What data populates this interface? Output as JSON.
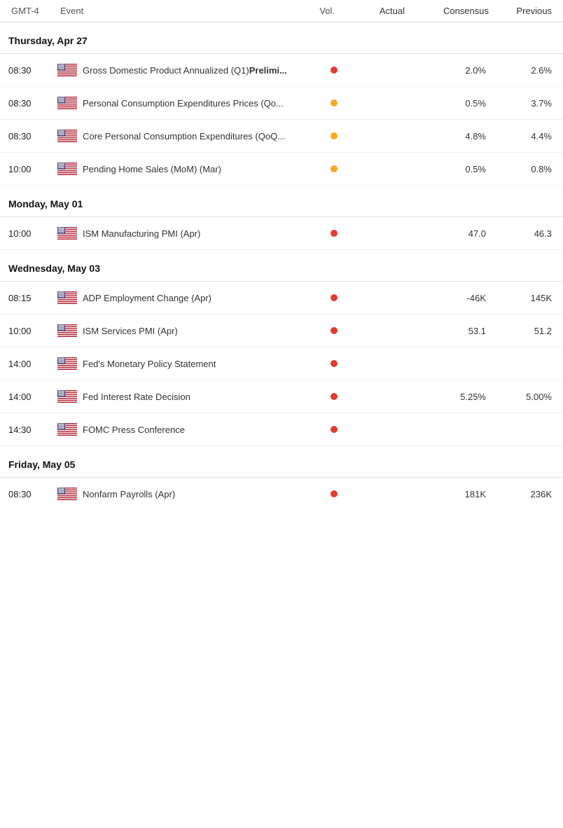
{
  "header": {
    "col_time": "GMT-4",
    "col_event": "Event",
    "col_vol": "Vol.",
    "col_actual": "Actual",
    "col_consensus": "Consensus",
    "col_previous": "Previous"
  },
  "sections": [
    {
      "id": "thu-apr-27",
      "title": "Thursday, Apr 27",
      "events": [
        {
          "time": "08:30",
          "flag": "us",
          "event_prefix": "Gross Domestic Product Annualized (Q1)",
          "event_bold": "Prelimi...",
          "dot_color": "red",
          "actual": "",
          "consensus": "2.0%",
          "previous": "2.6%"
        },
        {
          "time": "08:30",
          "flag": "us",
          "event_prefix": "Personal Consumption Expenditures Prices (Qo...",
          "event_bold": "",
          "dot_color": "yellow",
          "actual": "",
          "consensus": "0.5%",
          "previous": "3.7%"
        },
        {
          "time": "08:30",
          "flag": "us",
          "event_prefix": "Core Personal Consumption Expenditures (QoQ...",
          "event_bold": "",
          "dot_color": "yellow",
          "actual": "",
          "consensus": "4.8%",
          "previous": "4.4%"
        },
        {
          "time": "10:00",
          "flag": "us",
          "event_prefix": "Pending Home Sales (MoM) (Mar)",
          "event_bold": "",
          "dot_color": "yellow",
          "actual": "",
          "consensus": "0.5%",
          "previous": "0.8%"
        }
      ]
    },
    {
      "id": "mon-may-01",
      "title": "Monday, May 01",
      "events": [
        {
          "time": "10:00",
          "flag": "us",
          "event_prefix": "ISM Manufacturing PMI (Apr)",
          "event_bold": "",
          "dot_color": "red",
          "actual": "",
          "consensus": "47.0",
          "previous": "46.3"
        }
      ]
    },
    {
      "id": "wed-may-03",
      "title": "Wednesday, May 03",
      "events": [
        {
          "time": "08:15",
          "flag": "us",
          "event_prefix": "ADP Employment Change (Apr)",
          "event_bold": "",
          "dot_color": "red",
          "actual": "",
          "consensus": "-46K",
          "previous": "145K"
        },
        {
          "time": "10:00",
          "flag": "us",
          "event_prefix": "ISM Services PMI (Apr)",
          "event_bold": "",
          "dot_color": "red",
          "actual": "",
          "consensus": "53.1",
          "previous": "51.2"
        },
        {
          "time": "14:00",
          "flag": "us",
          "event_prefix": "Fed's Monetary Policy Statement",
          "event_bold": "",
          "dot_color": "red",
          "actual": "",
          "consensus": "",
          "previous": ""
        },
        {
          "time": "14:00",
          "flag": "us",
          "event_prefix": "Fed Interest Rate Decision",
          "event_bold": "",
          "dot_color": "red",
          "actual": "",
          "consensus": "5.25%",
          "previous": "5.00%"
        },
        {
          "time": "14:30",
          "flag": "us",
          "event_prefix": "FOMC Press Conference",
          "event_bold": "",
          "dot_color": "red",
          "actual": "",
          "consensus": "",
          "previous": ""
        }
      ]
    },
    {
      "id": "fri-may-05",
      "title": "Friday, May 05",
      "events": [
        {
          "time": "08:30",
          "flag": "us",
          "event_prefix": "Nonfarm Payrolls (Apr)",
          "event_bold": "",
          "dot_color": "red",
          "actual": "",
          "consensus": "181K",
          "previous": "236K"
        }
      ]
    }
  ]
}
